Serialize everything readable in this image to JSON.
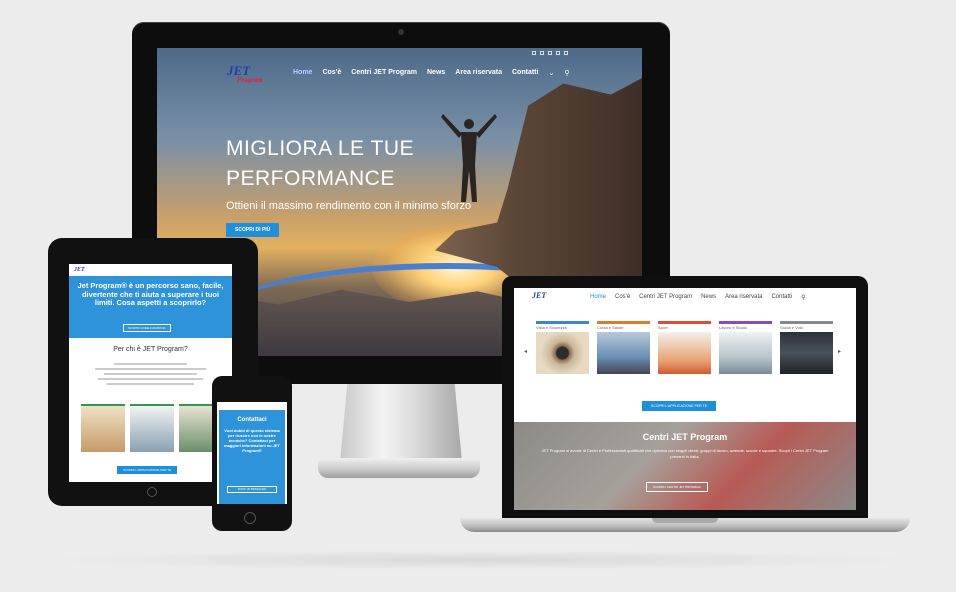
{
  "monitor": {
    "logo": "JET",
    "logo_sub": "Program",
    "nav": [
      "Home",
      "Cos'è",
      "Centri JET Program",
      "News",
      "Area riservata",
      "Contatti",
      "⌄",
      "⚲"
    ],
    "hero_title": "MIGLIORA LE TUE PERFORMANCE",
    "hero_subtitle": "Ottieni il massimo rendimento con il minimo sforzo",
    "hero_button": "SCOPRI DI PIÙ"
  },
  "tablet": {
    "logo": "JET",
    "hero_text": "Jet Program® è un percorso sano, facile, divertente che ti aiuta a superare i tuoi limiti. Cosa aspetti a scoprirlo?",
    "hero_button": "SCOPRI COME FUNZIONA",
    "section_title": "Per chi è JET Program?",
    "cta_button": "SCOPRI L'APPLICAZIONE PER TE"
  },
  "phone": {
    "title": "Contattaci",
    "text": "Vuoi dubbi di questo sistema per riuscire con le nostre tecniche? Contattaci per maggiori informazioni su JET Program®",
    "button": "SCRIVI UN MESSAGGIO"
  },
  "laptop": {
    "logo": "JET",
    "nav": [
      "Home",
      "Cos'è",
      "Centri JET Program",
      "News",
      "Area riservata",
      "Contatti",
      "⚲"
    ],
    "cards": [
      {
        "label": "Vista e Sicurezza",
        "bar_color": "#3a88c8",
        "img_color": "#c9b89a"
      },
      {
        "label": "Corsa e Salute",
        "bar_color": "#e07b2a",
        "img_color": "#6a8fb5"
      },
      {
        "label": "Sport",
        "bar_color": "#d85030",
        "img_color": "#e8a070"
      },
      {
        "label": "Lavoro e Studio",
        "bar_color": "#8a4bb5",
        "img_color": "#b8c4cc"
      },
      {
        "label": "Guida e Volo",
        "bar_color": "#888888",
        "img_color": "#48525a"
      }
    ],
    "apps_button": "SCOPRI L'APPLICAZIONE PER TE",
    "centri_title": "Centri JET Program",
    "centri_text": "JET Program si avvale di Centri e Professionisti qualificati che operano con singoli utenti, gruppi di lavoro, aziende, scuole e squadre. Scopri i Centri JET Program presenti in Italia.",
    "centri_button": "SCOPRI I CENTRI JET PROGRAM"
  }
}
